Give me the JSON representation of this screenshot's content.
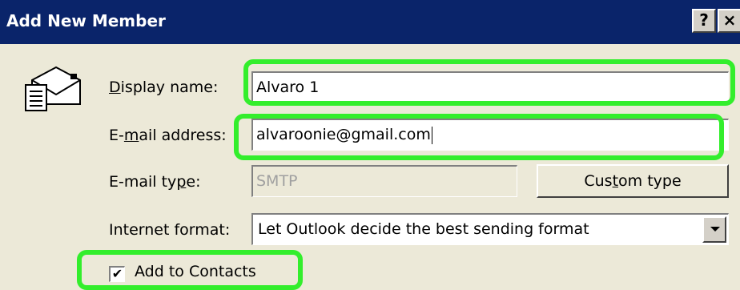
{
  "window": {
    "title": "Add New Member",
    "help_button": "?",
    "close_button": "×"
  },
  "form": {
    "display_name": {
      "label_prefix": "",
      "label_underline": "D",
      "label_suffix": "isplay name:",
      "value": "Alvaro 1"
    },
    "email_address": {
      "label_prefix": "E-",
      "label_underline": "m",
      "label_suffix": "ail address:",
      "value": "alvaroonie@gmail.com"
    },
    "email_type": {
      "label_prefix": "E-mail ty",
      "label_underline": "p",
      "label_suffix": "e:",
      "value": "SMTP",
      "custom_type_button": {
        "prefix": "Cus",
        "underline": "t",
        "suffix": "om type"
      }
    },
    "internet_format": {
      "label": "Internet format:",
      "selected": "Let Outlook decide the best sending format"
    },
    "add_to_contacts": {
      "checked": true,
      "mark": "✔",
      "label": "Add to Contacts"
    }
  },
  "colors": {
    "title_bar": "#0a246a",
    "dialog_background": "#ece9d8",
    "highlight": "#33ee2c"
  },
  "icons": {
    "dialog": "contact-card-icon",
    "dropdown": "chevron-down-icon"
  }
}
